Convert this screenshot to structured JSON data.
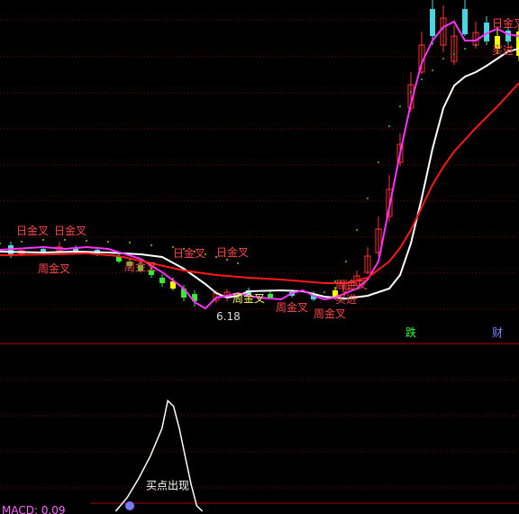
{
  "chart_data": {
    "type": "line",
    "panes": {
      "price": {
        "ylim": [
          0,
          380
        ]
      },
      "indicator": {
        "ylim": [
          0,
          60
        ],
        "footer_text": "MACD: 0.09"
      }
    },
    "x_days": 96,
    "series": [
      {
        "key": "ma_white",
        "color": "#ffffff",
        "points": [
          [
            0,
            101
          ],
          [
            8,
            100
          ],
          [
            14,
            101
          ],
          [
            20,
            100
          ],
          [
            26,
            98
          ],
          [
            30,
            95
          ],
          [
            34,
            82
          ],
          [
            38,
            65
          ],
          [
            40,
            55
          ],
          [
            42,
            50
          ],
          [
            44,
            52
          ],
          [
            46,
            57
          ],
          [
            52,
            58
          ],
          [
            56,
            57
          ],
          [
            60,
            51
          ],
          [
            64,
            49
          ],
          [
            68,
            52
          ],
          [
            72,
            60
          ],
          [
            74,
            75
          ],
          [
            76,
            110
          ],
          [
            78,
            160
          ],
          [
            80,
            215
          ],
          [
            82,
            260
          ],
          [
            84,
            285
          ],
          [
            86,
            295
          ],
          [
            88,
            300
          ],
          [
            90,
            307
          ],
          [
            92,
            315
          ],
          [
            94,
            323
          ],
          [
            96,
            326
          ]
        ]
      },
      {
        "key": "ma_magenta",
        "color": "#ff33ff",
        "points": [
          [
            0,
            103
          ],
          [
            8,
            106
          ],
          [
            12,
            104
          ],
          [
            16,
            106
          ],
          [
            20,
            104
          ],
          [
            26,
            93
          ],
          [
            30,
            78
          ],
          [
            34,
            60
          ],
          [
            36,
            45
          ],
          [
            38,
            38
          ],
          [
            40,
            50
          ],
          [
            42,
            52
          ],
          [
            44,
            55
          ],
          [
            46,
            52
          ],
          [
            48,
            50
          ],
          [
            52,
            48
          ],
          [
            54,
            55
          ],
          [
            56,
            58
          ],
          [
            58,
            52
          ],
          [
            60,
            48
          ],
          [
            62,
            50
          ],
          [
            64,
            55
          ],
          [
            66,
            60
          ],
          [
            68,
            70
          ],
          [
            70,
            90
          ],
          [
            72,
            150
          ],
          [
            74,
            210
          ],
          [
            76,
            265
          ],
          [
            78,
            310
          ],
          [
            80,
            335
          ],
          [
            82,
            350
          ],
          [
            84,
            356
          ],
          [
            86,
            335
          ],
          [
            88,
            335
          ],
          [
            90,
            343
          ],
          [
            92,
            348
          ],
          [
            94,
            342
          ],
          [
            96,
            340
          ]
        ]
      },
      {
        "key": "ma_red",
        "color": "#ff1a1a",
        "points": [
          [
            0,
            97
          ],
          [
            10,
            98
          ],
          [
            16,
            99
          ],
          [
            22,
            96
          ],
          [
            28,
            88
          ],
          [
            34,
            80
          ],
          [
            40,
            75
          ],
          [
            46,
            72
          ],
          [
            52,
            70
          ],
          [
            56,
            68
          ],
          [
            60,
            66
          ],
          [
            64,
            66
          ],
          [
            68,
            72
          ],
          [
            72,
            90
          ],
          [
            74,
            105
          ],
          [
            76,
            125
          ],
          [
            78,
            150
          ],
          [
            80,
            175
          ],
          [
            82,
            195
          ],
          [
            84,
            212
          ],
          [
            86,
            225
          ],
          [
            88,
            238
          ],
          [
            90,
            250
          ],
          [
            92,
            262
          ],
          [
            94,
            275
          ],
          [
            96,
            288
          ]
        ]
      },
      {
        "key": "dots_green",
        "color": "#33cc33",
        "points": [
          [
            58,
            52
          ],
          [
            60,
            56
          ],
          [
            62,
            68
          ],
          [
            64,
            90
          ],
          [
            66,
            125
          ],
          [
            68,
            160
          ],
          [
            70,
            200
          ],
          [
            72,
            240
          ],
          [
            74,
            262
          ],
          [
            76,
            278
          ],
          [
            78,
            292
          ],
          [
            80,
            302
          ],
          [
            82,
            315
          ],
          [
            84,
            320
          ],
          [
            86,
            326
          ],
          [
            88,
            330
          ],
          [
            90,
            335
          ],
          [
            92,
            330
          ],
          [
            94,
            334
          ],
          [
            96,
            338
          ]
        ]
      },
      {
        "key": "dots_yellow",
        "color": "#c8b400",
        "points": [
          [
            0,
            110
          ],
          [
            4,
            112
          ],
          [
            8,
            114
          ],
          [
            12,
            114
          ],
          [
            16,
            113
          ],
          [
            20,
            112
          ],
          [
            24,
            111
          ],
          [
            28,
            108
          ],
          [
            32,
            106
          ],
          [
            34,
            104
          ],
          [
            36,
            101
          ],
          [
            38,
            98
          ],
          [
            40,
            95
          ],
          [
            42,
            92
          ],
          [
            44,
            88
          ]
        ]
      }
    ],
    "annotations": [
      {
        "text": "日金叉",
        "day": 3,
        "y": 120,
        "color": "#ff4a4a"
      },
      {
        "text": "日金叉",
        "day": 10,
        "y": 120,
        "color": "#ff4a4a"
      },
      {
        "text": "周金叉",
        "day": 7,
        "y": 78,
        "color": "#ff4a4a"
      },
      {
        "text": "周金叉",
        "day": 23,
        "y": 80,
        "color": "#ff4a4a"
      },
      {
        "text": "日金叉",
        "day": 32,
        "y": 95,
        "color": "#ff4a4a"
      },
      {
        "text": "日金叉",
        "day": 40,
        "y": 96,
        "color": "#ff4a4a"
      },
      {
        "text": "周金叉",
        "day": 43,
        "y": 45,
        "color": "#ffff66"
      },
      {
        "text": "周金叉",
        "day": 51,
        "y": 35,
        "color": "#ff4a4a"
      },
      {
        "text": "周金叉",
        "day": 58,
        "y": 28,
        "color": "#ff4a4a"
      },
      {
        "text": "周金叉",
        "day": 62,
        "y": 60,
        "color": "#ff4a4a"
      },
      {
        "text": "买进",
        "day": 62,
        "y": 44,
        "color": "#ff4a4a"
      },
      {
        "text": "6.18",
        "day": 40,
        "y": 25,
        "color": "#dddddd"
      },
      {
        "text": "跌",
        "day": 75,
        "y": 7,
        "color": "#33ff33"
      },
      {
        "text": "财",
        "day": 102,
        "y": 7,
        "color": "#8888ff"
      },
      {
        "text": "日金叉",
        "day": 104,
        "y": 350,
        "color": "#ff4a4a"
      },
      {
        "text": "买进",
        "day": 109,
        "y": 320,
        "color": "#ff4a4a"
      },
      {
        "text": "买点出现",
        "day": 27,
        "y": 8,
        "pane": "indicator",
        "color": "#ffffff"
      }
    ]
  }
}
